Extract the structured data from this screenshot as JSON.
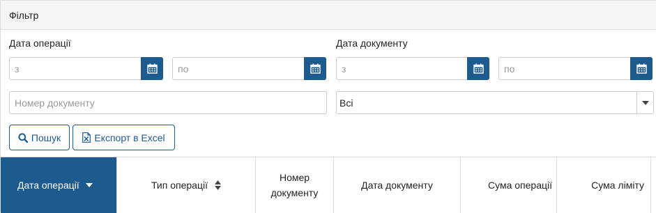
{
  "filter_panel": {
    "title": "Фільтр",
    "operation_date": {
      "label": "Дата операції",
      "from_placeholder": "з",
      "to_placeholder": "по"
    },
    "document_date": {
      "label": "Дата документу",
      "from_placeholder": "з",
      "to_placeholder": "по"
    },
    "document_number": {
      "placeholder": "Номер документу"
    },
    "type_select": {
      "value": "Всі"
    },
    "buttons": {
      "search": "Пошук",
      "export": "Експорт в Excel"
    }
  },
  "grid": {
    "columns": [
      {
        "label": "Дата операції",
        "sort": "desc",
        "active": true
      },
      {
        "label": "Тип операції",
        "sort": "both",
        "active": false
      },
      {
        "label": "Номер документу",
        "sort": null,
        "active": false
      },
      {
        "label": "Дата документу",
        "sort": null,
        "active": false
      },
      {
        "label": "Сума операції",
        "sort": null,
        "active": false
      },
      {
        "label": "Сума ліміту",
        "sort": null,
        "active": false
      }
    ]
  },
  "colors": {
    "primary": "#1d5a8e",
    "heading_bg": "#f5f5f5",
    "border": "#dcdcdc"
  },
  "icons": {
    "calendar": "calendar-icon",
    "search": "search-icon",
    "excel": "excel-file-icon",
    "select_caret": "caret-down-icon"
  }
}
